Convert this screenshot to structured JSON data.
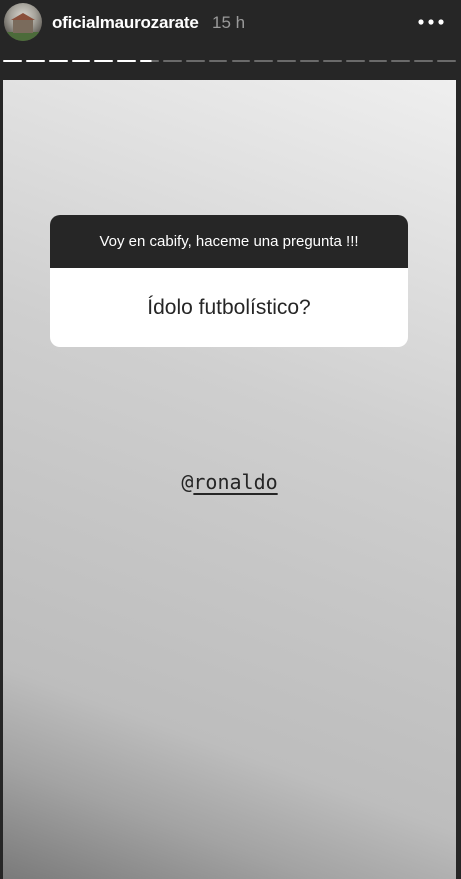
{
  "header": {
    "username": "oficialmaurozarate",
    "time": "15 h",
    "more_icon": "more-horizontal-icon"
  },
  "progress": {
    "total_segments": 20,
    "completed_segments": 6,
    "current_segment_fraction": 0.6
  },
  "story": {
    "question_sticker": {
      "prompt": "Voy en cabify, haceme una pregunta !!!",
      "answer": "Ídolo futbolístico?"
    },
    "mention": {
      "at": "@",
      "handle": "ronaldo"
    }
  },
  "colors": {
    "header_bg": "#262626",
    "username": "#ffffff",
    "time": "#9a9a9a",
    "progress_done": "#ffffff",
    "progress_pending": "#6a6a6a"
  }
}
